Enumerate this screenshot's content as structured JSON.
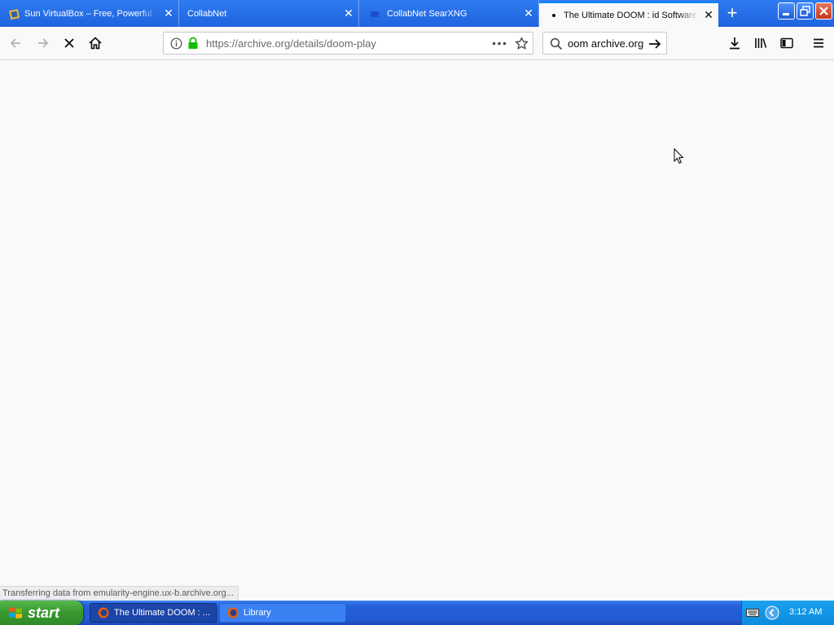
{
  "browser": {
    "tabs": [
      {
        "label": "Sun VirtualBox – Free, Powerful",
        "active": false,
        "favicon": "virtualbox-icon"
      },
      {
        "label": "CollabNet",
        "active": false,
        "favicon": "none"
      },
      {
        "label": "CollabNet SearXNG",
        "active": false,
        "favicon": "searxng-icon"
      },
      {
        "label": "The Ultimate DOOM : id Software",
        "active": true,
        "favicon": "loading-dot-icon"
      }
    ],
    "new_tab_symbol": "+",
    "window_controls": {
      "minimize": "_",
      "maximize": "❐",
      "close": "✕"
    },
    "url": "https://archive.org/details/doom-play",
    "search_value": "oom archive.org",
    "page_state": "loading"
  },
  "status_bar": {
    "text": "Transferring data from emularity-engine.ux-b.archive.org..."
  },
  "taskbar": {
    "start_label": "start",
    "tasks": [
      {
        "label": "The Ultimate DOOM : ...",
        "active": true
      },
      {
        "label": "Library",
        "active": false
      }
    ],
    "clock": "3:12 AM"
  },
  "colors": {
    "tab_strip": "#1f63e0",
    "active_tab_accent": "#0a84ff",
    "secure_lock": "#12bc00",
    "taskbar": "#225bd3",
    "start_button": "#3a9a31"
  }
}
